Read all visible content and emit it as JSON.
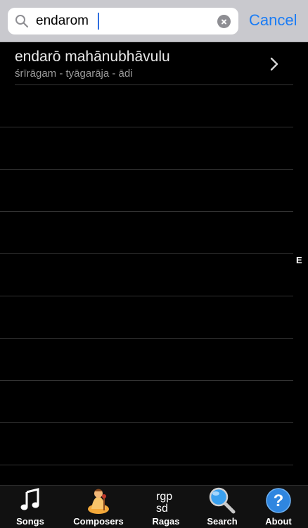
{
  "search": {
    "value": "endarom",
    "cancel_label": "Cancel"
  },
  "results": [
    {
      "title": "endarō mahānubhāvulu",
      "subtitle": "śrīrāgam - tyāgarāja - ādi"
    }
  ],
  "index": {
    "letter": "E"
  },
  "tabs": [
    {
      "label": "Songs",
      "icon": "music-note-icon"
    },
    {
      "label": "Composers",
      "icon": "composer-icon"
    },
    {
      "label": "Ragas",
      "icon": "ragas-icon",
      "glyph_top": "rgp",
      "glyph_bottom": "sd"
    },
    {
      "label": "Search",
      "icon": "magnifier-icon"
    },
    {
      "label": "About",
      "icon": "help-icon",
      "glyph": "?"
    }
  ],
  "colors": {
    "accent": "#1a7cf5",
    "header_bg": "#c9c9ce",
    "background": "#000000",
    "title_text": "#e8e8e8",
    "subtitle_text": "#9a9a9a",
    "separator": "#333333",
    "caret": "#2f6fe0"
  }
}
